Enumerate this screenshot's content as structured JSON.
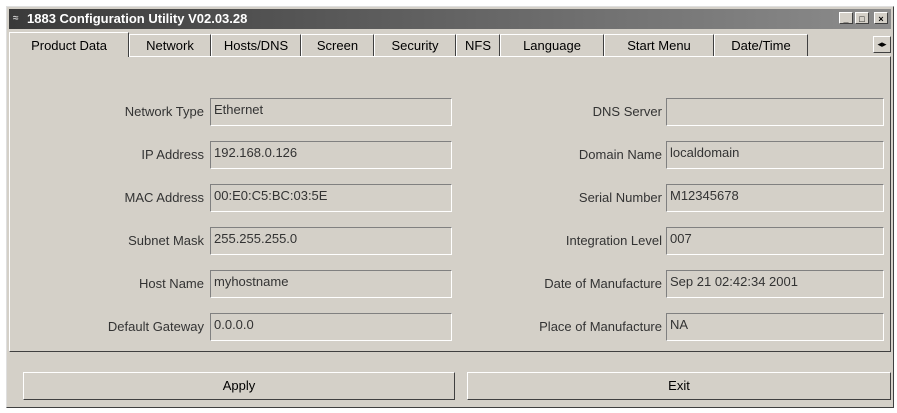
{
  "window": {
    "title": "1883 Configuration Utility V02.03.28",
    "sys_icon": "≈"
  },
  "titlebar_buttons": {
    "minimize": "_",
    "maximize": "□",
    "close": "×"
  },
  "tabs": [
    {
      "label": "Product Data",
      "active": true
    },
    {
      "label": "Network"
    },
    {
      "label": "Hosts/DNS"
    },
    {
      "label": "Screen"
    },
    {
      "label": "Security"
    },
    {
      "label": "NFS"
    },
    {
      "label": "Language"
    },
    {
      "label": "Start Menu"
    },
    {
      "label": "Date/Time"
    }
  ],
  "tab_scroll": "◂▸",
  "left_fields": [
    {
      "label": "Network Type",
      "value": "Ethernet"
    },
    {
      "label": "IP Address",
      "value": "192.168.0.126"
    },
    {
      "label": "MAC Address",
      "value": "00:E0:C5:BC:03:5E"
    },
    {
      "label": "Subnet Mask",
      "value": "255.255.255.0"
    },
    {
      "label": "Host Name",
      "value": "myhostname"
    },
    {
      "label": "Default Gateway",
      "value": "0.0.0.0"
    }
  ],
  "right_fields": [
    {
      "label": "DNS Server",
      "value": ""
    },
    {
      "label": "Domain Name",
      "value": "localdomain"
    },
    {
      "label": "Serial Number",
      "value": "M12345678"
    },
    {
      "label": "Integration Level",
      "value": "007"
    },
    {
      "label": "Date of Manufacture",
      "value": "Sep 21 02:42:34 2001"
    },
    {
      "label": "Place of Manufacture",
      "value": "NA"
    }
  ],
  "buttons": {
    "apply": "Apply",
    "exit": "Exit"
  }
}
